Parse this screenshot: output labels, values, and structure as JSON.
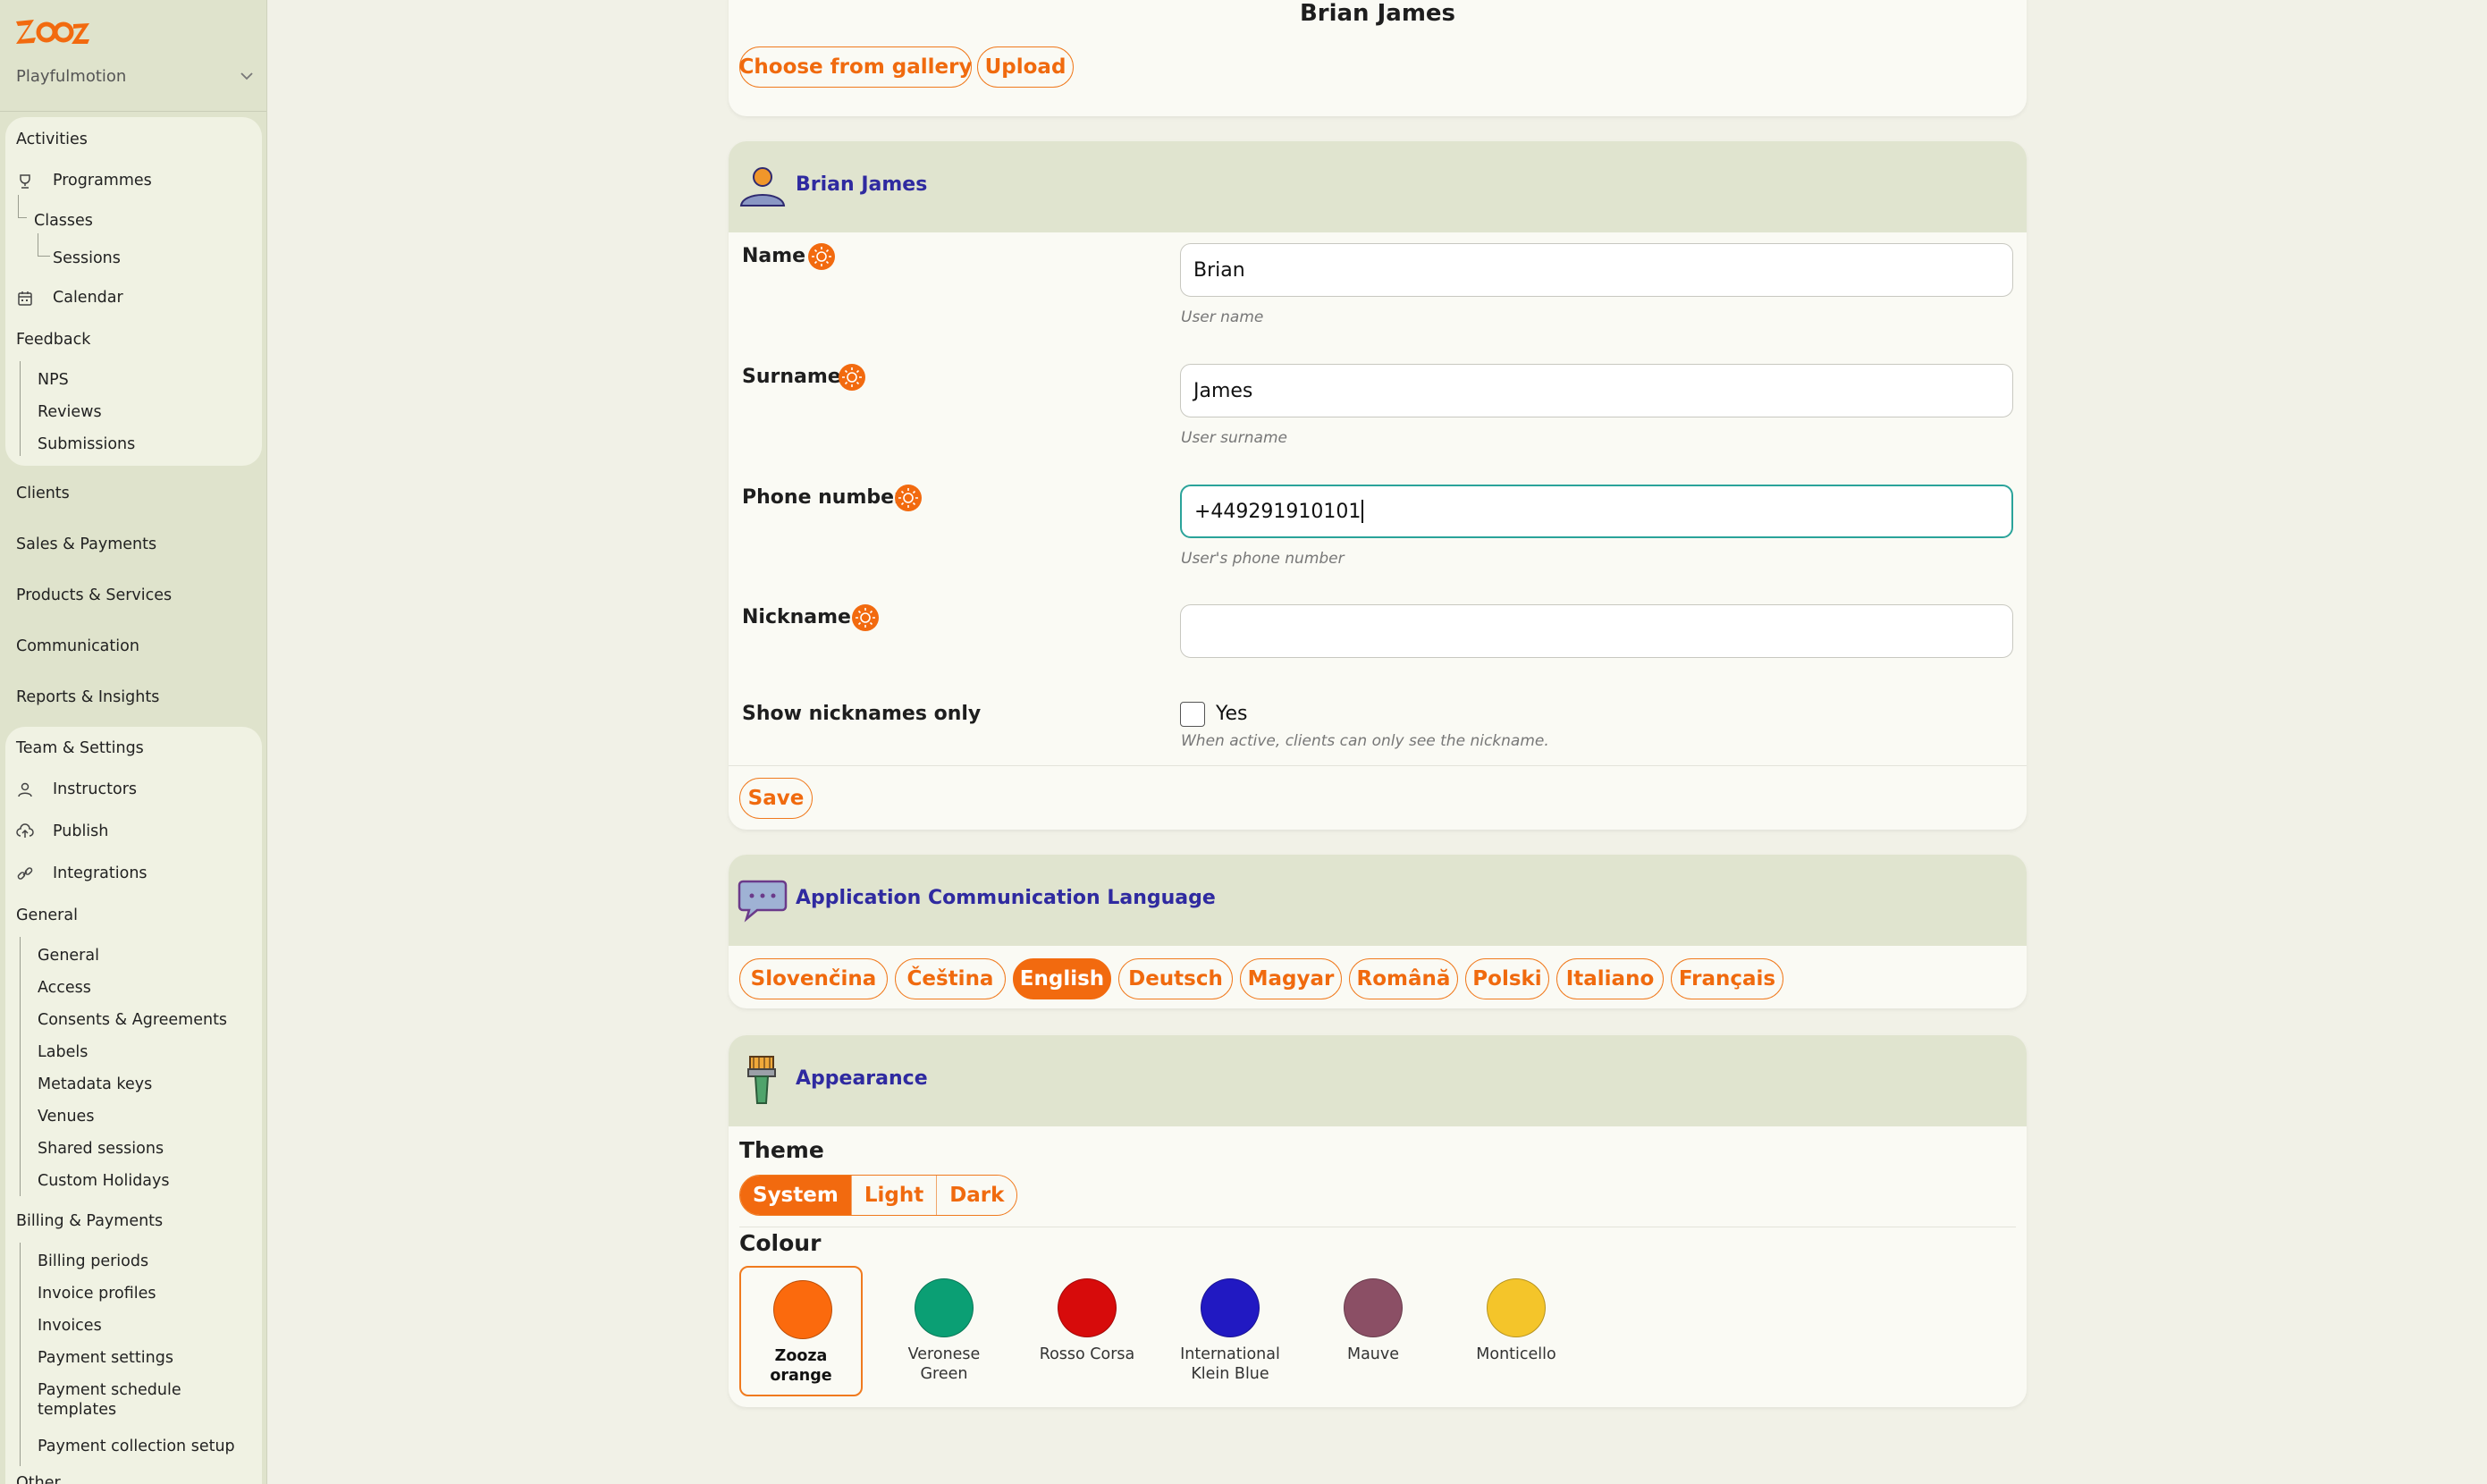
{
  "sidebar": {
    "brand": "Zooza",
    "workspace": "Playfulmotion",
    "activities": {
      "header": "Activities",
      "programmes": "Programmes",
      "classes": "Classes",
      "sessions": "Sessions",
      "calendar": "Calendar",
      "feedback": "Feedback",
      "feedback_items": [
        "NPS",
        "Reviews",
        "Submissions"
      ]
    },
    "main_links": [
      "Clients",
      "Sales & Payments",
      "Products & Services",
      "Communication",
      "Reports & Insights"
    ],
    "team": {
      "header": "Team & Settings",
      "instructors": "Instructors",
      "publish": "Publish",
      "integrations": "Integrations",
      "general_header": "General",
      "general_items": [
        "General",
        "Access",
        "Consents & Agreements",
        "Labels",
        "Metadata keys",
        "Venues",
        "Shared sessions",
        "Custom Holidays"
      ],
      "billing_header": "Billing & Payments",
      "billing_items": [
        "Billing periods",
        "Invoice profiles",
        "Invoices",
        "Payment settings",
        "Payment schedule templates",
        "Payment collection setup"
      ],
      "other_header": "Other"
    }
  },
  "photo_card": {
    "user_name": "Brian James",
    "choose_label": "Choose from gallery",
    "upload_label": "Upload"
  },
  "profile_card": {
    "title": "Brian James",
    "fields": {
      "name": {
        "label": "Name",
        "value": "Brian",
        "help": "User name"
      },
      "surname": {
        "label": "Surname",
        "value": "James",
        "help": "User surname"
      },
      "phone": {
        "label": "Phone number",
        "value": "+449291910101",
        "help": "User's phone number"
      },
      "nickname": {
        "label": "Nickname",
        "value": ""
      }
    },
    "show_nick": {
      "label": "Show nicknames only",
      "checkbox_label": "Yes",
      "checked": false,
      "help": "When active, clients can only see the nickname."
    },
    "save_label": "Save"
  },
  "language_card": {
    "title": "Application Communication Language",
    "languages": [
      "Slovenčina",
      "Čeština",
      "English",
      "Deutsch",
      "Magyar",
      "Română",
      "Polski",
      "Italiano",
      "Français"
    ],
    "selected": "English"
  },
  "appearance_card": {
    "title": "Appearance",
    "theme_label": "Theme",
    "themes": [
      "System",
      "Light",
      "Dark"
    ],
    "selected_theme": "System",
    "colour_label": "Colour",
    "colours": [
      {
        "name": "Zooza orange",
        "hex": "#fb6a0d",
        "selected": true
      },
      {
        "name": "Veronese Green",
        "hex": "#0b9f74",
        "selected": false
      },
      {
        "name": "Rosso Corsa",
        "hex": "#d70b0b",
        "selected": false
      },
      {
        "name": "International Klein Blue",
        "hex": "#2119c2",
        "selected": false
      },
      {
        "name": "Mauve",
        "hex": "#8b4f65",
        "selected": false
      },
      {
        "name": "Monticello",
        "hex": "#f4c52a",
        "selected": false
      }
    ]
  },
  "colors": {
    "accent": "#f26a0f",
    "title_blue": "#2f2aa0",
    "focus": "#2aa39a",
    "sidebar_bg": "#dfe3cc"
  }
}
